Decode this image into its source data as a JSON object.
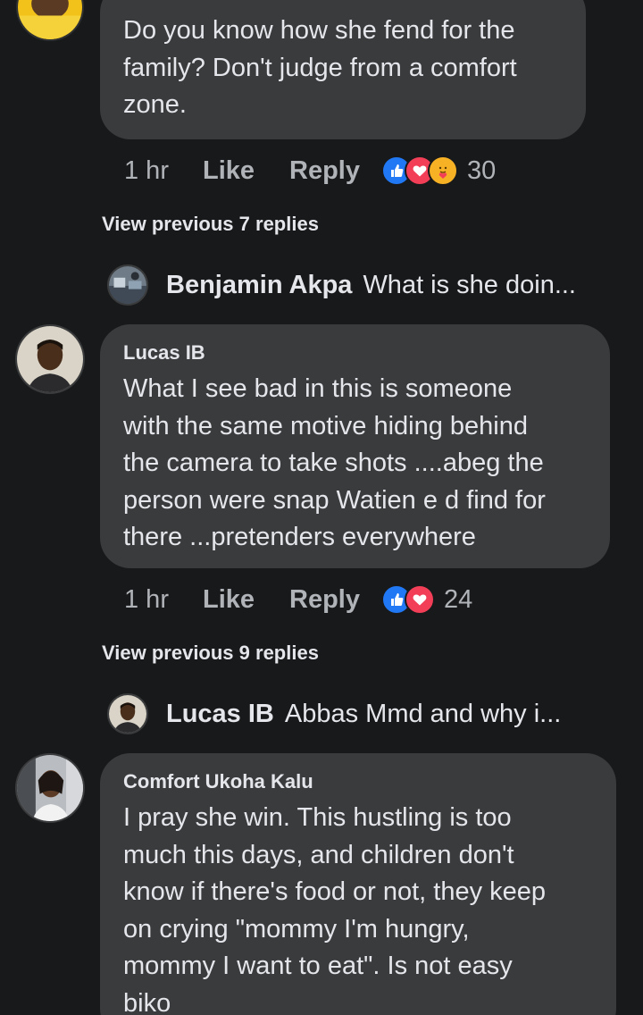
{
  "comment_top": {
    "text": "Do you know how she fend for the\nfamily? Don't judge from a comfort\nzone.",
    "time": "1 hr",
    "like_label": "Like",
    "reply_label": "Reply",
    "reactions": [
      "like",
      "love",
      "care"
    ],
    "reaction_count": "30",
    "view_previous": "View previous 7 replies",
    "latest_reply": {
      "author": "Benjamin Akpa",
      "preview": "What is she doin..."
    }
  },
  "comment_lucas": {
    "author": "Lucas IB",
    "text": "What I see bad in this is someone\nwith the same motive hiding behind\nthe camera to take shots ....abeg the\nperson were snap Watien e d find for\nthere ...pretenders everywhere",
    "time": "1 hr",
    "like_label": "Like",
    "reply_label": "Reply",
    "reactions": [
      "like",
      "love"
    ],
    "reaction_count": "24",
    "view_previous": "View previous 9 replies",
    "latest_reply": {
      "author": "Lucas IB",
      "preview": "Abbas Mmd and why i..."
    }
  },
  "comment_comfort": {
    "author": "Comfort Ukoha Kalu",
    "text": "I pray she win. This hustling is too\nmuch this days, and children don't\nknow if there's food or not,  they keep\non crying \"mommy I'm hungry,\nmommy I want to eat\". Is not easy\nbiko"
  },
  "colors": {
    "background": "#18191a",
    "bubble": "#3a3b3c",
    "text": "#e4e6eb",
    "secondary_text": "#b0b3b8",
    "like_blue": "#2078f4",
    "love_red": "#f33e58",
    "care_yellow": "#f7b125"
  }
}
